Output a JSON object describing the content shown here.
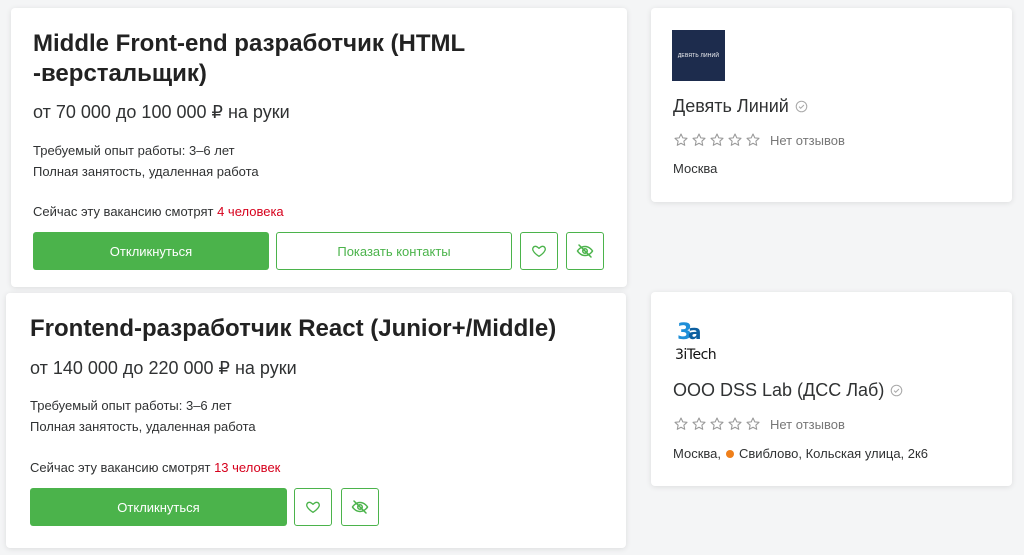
{
  "colors": {
    "accent": "#4bb34b",
    "highlight": "#d6001c",
    "metro_orange": "#ef7f1a",
    "logo_navy": "#1d2c4d",
    "logo_blue": "#1f8fd8"
  },
  "vacancies": [
    {
      "title": "Middle Front-end разработчик (HTML -верстальщик)",
      "salary": "от 70 000 до 100 000 ₽ на руки",
      "experience": "Требуемый опыт работы: 3–6 лет",
      "employment": "Полная занятость, удаленная работа",
      "viewers_prefix": "Сейчас эту вакансию смотрят ",
      "viewers_count": "4 человека",
      "apply_label": "Откликнуться",
      "contacts_label": "Показать контакты",
      "favorite_icon": "heart-icon",
      "hide_icon": "eye-off-icon"
    },
    {
      "title": "Frontend-разработчик React (Junior+/Middle)",
      "salary": "от 140 000 до 220 000 ₽ на руки",
      "experience": "Требуемый опыт работы: 3–6 лет",
      "employment": "Полная занятость, удаленная работа",
      "viewers_prefix": "Сейчас эту вакансию смотрят ",
      "viewers_count": "13 человек",
      "apply_label": "Откликнуться",
      "favorite_icon": "heart-icon",
      "hide_icon": "eye-off-icon"
    }
  ],
  "employers": [
    {
      "logo_text": "ДЕВЯТЬ ЛИНИЙ",
      "name": "Девять Линий",
      "verified_icon": "check-circle-icon",
      "rating_icon": "star-outline-icon",
      "reviews": "Нет отзывов",
      "location": "Москва"
    },
    {
      "logo_text": "3iTech",
      "name": "ООО DSS Lab (ДСС Лаб)",
      "verified_icon": "check-circle-icon",
      "rating_icon": "star-outline-icon",
      "reviews": "Нет отзывов",
      "location_city": "Москва,",
      "location_rest": "Свиблово, Кольская улица, 2к6"
    }
  ]
}
